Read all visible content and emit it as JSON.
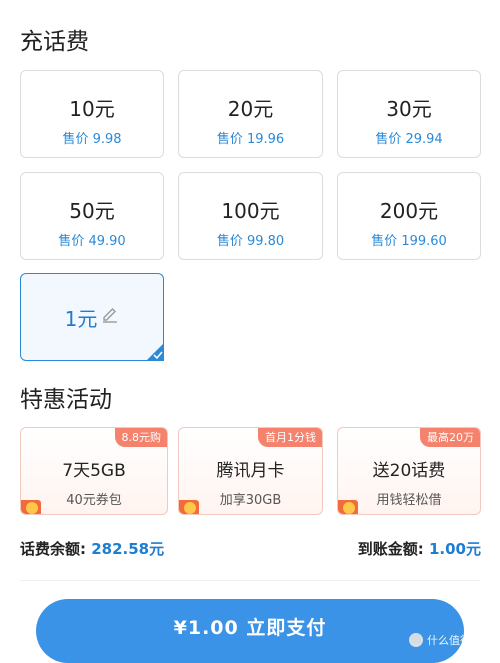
{
  "recharge": {
    "title": "充话费",
    "options": [
      {
        "amount": "10元",
        "price": "售价 9.98"
      },
      {
        "amount": "20元",
        "price": "售价 19.96"
      },
      {
        "amount": "30元",
        "price": "售价 29.94"
      },
      {
        "amount": "50元",
        "price": "售价 49.90"
      },
      {
        "amount": "100元",
        "price": "售价 99.80"
      },
      {
        "amount": "200元",
        "price": "售价 199.60"
      }
    ],
    "custom_amount": "1元",
    "icons": {
      "edit": "pencil-icon",
      "selected": "checkmark-icon"
    }
  },
  "promotions": {
    "title": "特惠活动",
    "items": [
      {
        "badge": "8.8元购",
        "title": "7天5GB",
        "subtitle": "40元券包"
      },
      {
        "badge": "首月1分钱",
        "title": "腾讯月卡",
        "subtitle": "加享30GB"
      },
      {
        "badge": "最高20万",
        "title": "送20话费",
        "subtitle": "用钱轻松借"
      }
    ]
  },
  "summary": {
    "balance_label": "话费余额:",
    "balance_value": "282.58元",
    "received_label": "到账金额:",
    "received_value": "1.00元"
  },
  "pay": {
    "label": "¥1.00  立即支付"
  },
  "watermark": {
    "text": "什么值得买"
  },
  "colors": {
    "accent": "#2a8ad8",
    "pay_button": "#3a93e6",
    "badge": "#f5826c"
  }
}
